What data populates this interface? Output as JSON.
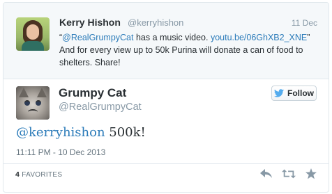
{
  "parent_tweet": {
    "name": "Kerry Hishon",
    "handle": "@kerryhishon",
    "date": "11 Dec",
    "text_quote_open": "“",
    "mention": "@RealGrumpyCat",
    "text_mid": " has a music video. ",
    "link": "youtu.be/06GhXB2_XNE",
    "text_quote_close": "”",
    "text_line2": "And for every view up to 50k Purina will donate a can of food to shelters. Share!"
  },
  "main_tweet": {
    "name": "Grumpy Cat",
    "handle": "@RealGrumpyCat",
    "follow_label": "Follow",
    "mention": "@kerryhishon",
    "text": " 500k!",
    "timestamp": "11:11 PM - 10 Dec 2013"
  },
  "footer": {
    "favorites_count": "4",
    "favorites_label": "FAVORITES"
  },
  "icons": {
    "follow": "twitter-bird-icon",
    "reply": "reply-icon",
    "retweet": "retweet-icon",
    "favorite": "star-icon"
  },
  "colors": {
    "link": "#2b7bb9",
    "twitter_blue": "#55acee",
    "muted": "#8899a6",
    "action_icon": "#8899a6"
  }
}
